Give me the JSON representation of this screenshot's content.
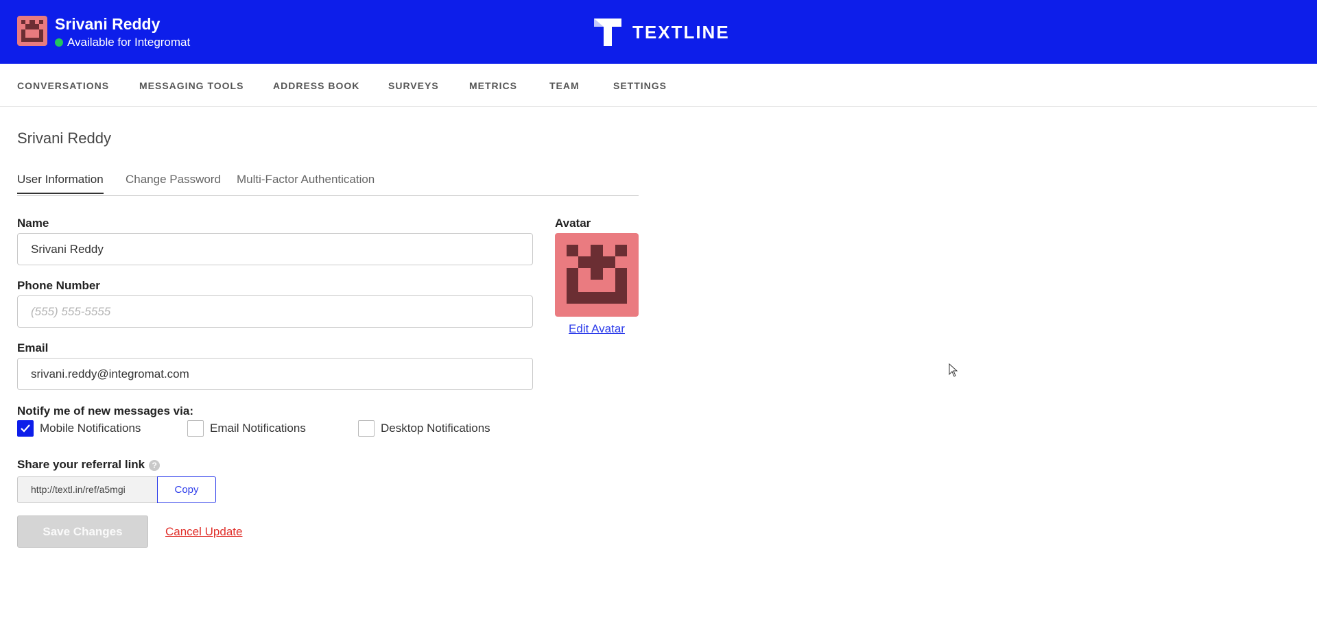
{
  "header": {
    "user_name": "Srivani Reddy",
    "status_text": "Available for Integromat",
    "brand_name": "TEXTLINE",
    "colors": {
      "bar": "#0d1eea",
      "status": "#22c55e",
      "avatar_bg": "#ea7b80",
      "avatar_fg": "#6b2e33"
    }
  },
  "nav": {
    "items": [
      "CONVERSATIONS",
      "MESSAGING TOOLS",
      "ADDRESS BOOK",
      "SURVEYS",
      "METRICS",
      "TEAM",
      "SETTINGS"
    ]
  },
  "page": {
    "title": "Srivani Reddy",
    "tabs": [
      {
        "label": "User Information",
        "active": true
      },
      {
        "label": "Change Password",
        "active": false
      },
      {
        "label": "Multi-Factor Authentication",
        "active": false
      }
    ]
  },
  "form": {
    "name_label": "Name",
    "name_value": "Srivani Reddy",
    "phone_label": "Phone Number",
    "phone_placeholder": "(555) 555-5555",
    "email_label": "Email",
    "email_value": "srivani.reddy@integromat.com",
    "avatar_label": "Avatar",
    "edit_avatar": "Edit Avatar",
    "notify_label": "Notify me of new messages via:",
    "notifications": [
      {
        "label": "Mobile Notifications",
        "checked": true
      },
      {
        "label": "Email Notifications",
        "checked": false
      },
      {
        "label": "Desktop Notifications",
        "checked": false
      }
    ],
    "referral_label": "Share your referral link",
    "referral_help": "?",
    "referral_link": "http://textl.in/ref/a5mgi",
    "copy_label": "Copy",
    "save_label": "Save Changes",
    "cancel_label": "Cancel Update"
  }
}
